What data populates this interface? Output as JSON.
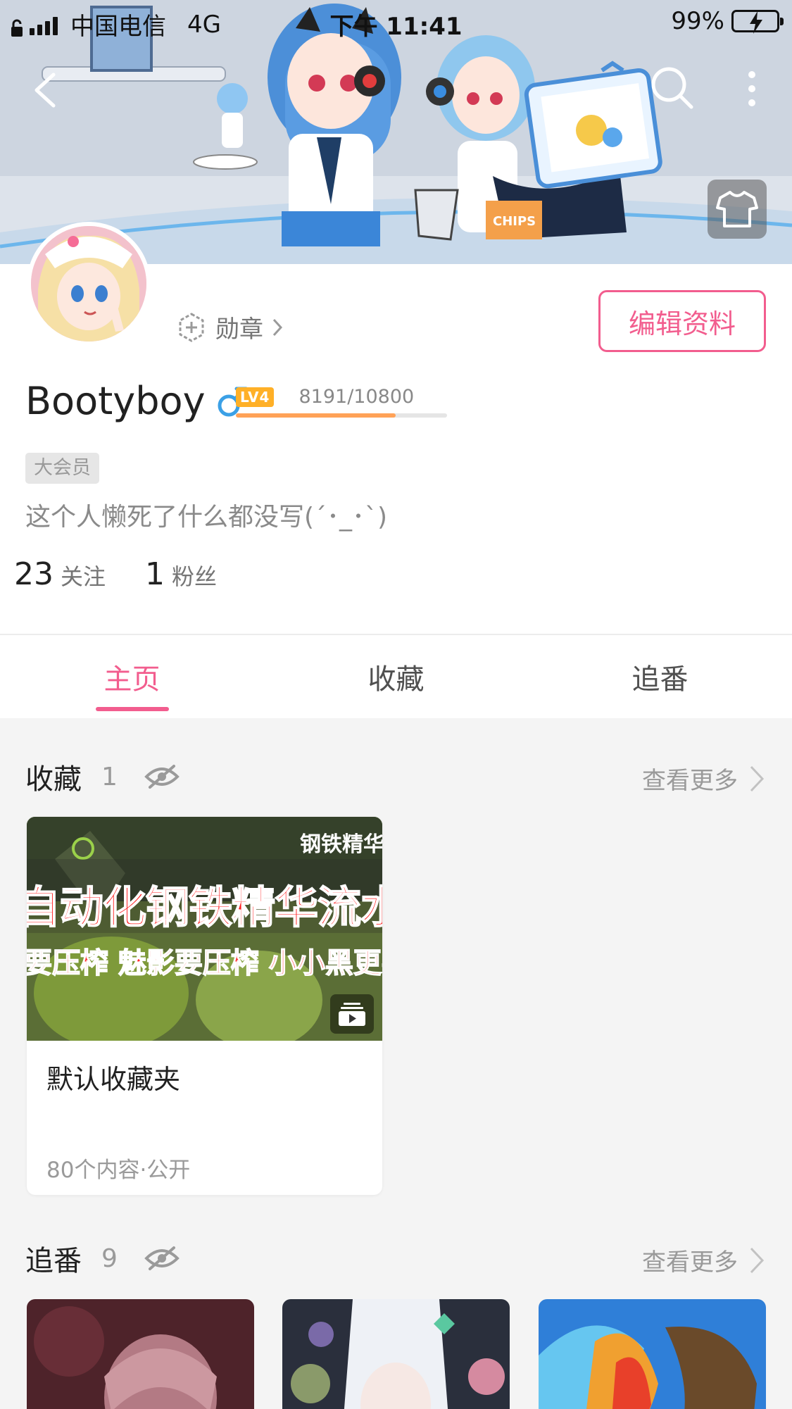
{
  "status_bar": {
    "carrier": "中国电信",
    "network": "4G",
    "time": "下午 11:41",
    "battery": "99%"
  },
  "icons": {
    "back": "chevron-left-icon",
    "search": "search-icon",
    "more": "more-vertical-icon",
    "skin": "tshirt-icon",
    "medal": "medal-icon",
    "gender": "male-icon",
    "hidden": "eye-off-icon",
    "arrow": "chevron-right-icon",
    "play": "video-collection-icon"
  },
  "profile": {
    "medal_label": "勋章",
    "edit_button": "编辑资料",
    "username": "Bootyboy",
    "level": "LV4",
    "exp_text": "8191/10800",
    "exp_progress": 0.758,
    "vip_tag": "大会员",
    "bio": "这个人懒死了什么都没写(´･_･`)",
    "following_count": "23",
    "following_label": "关注",
    "followers_count": "1",
    "followers_label": "粉丝"
  },
  "tabs": [
    {
      "label": "主页",
      "active": true
    },
    {
      "label": "收藏",
      "active": false
    },
    {
      "label": "追番",
      "active": false
    }
  ],
  "favorites": {
    "title": "收藏",
    "count": "1",
    "more_label": "查看更多",
    "folder": {
      "thumb_caption_top": "钢铁精华",
      "thumb_caption_1": "自动化钢铁精华流水",
      "thumb_caption_2": "要压榨 魅影要压榨 小小黑更要",
      "name": "默认收藏夹",
      "meta": "80个内容·公开"
    }
  },
  "bangumi": {
    "title": "追番",
    "count": "9",
    "more_label": "查看更多"
  },
  "colors": {
    "accent": "#f25d8e",
    "level_badge": "#ffb027",
    "exp_bar": "#ffa257",
    "male_blue": "#3ba0e6",
    "battery_green": "#35c759"
  }
}
